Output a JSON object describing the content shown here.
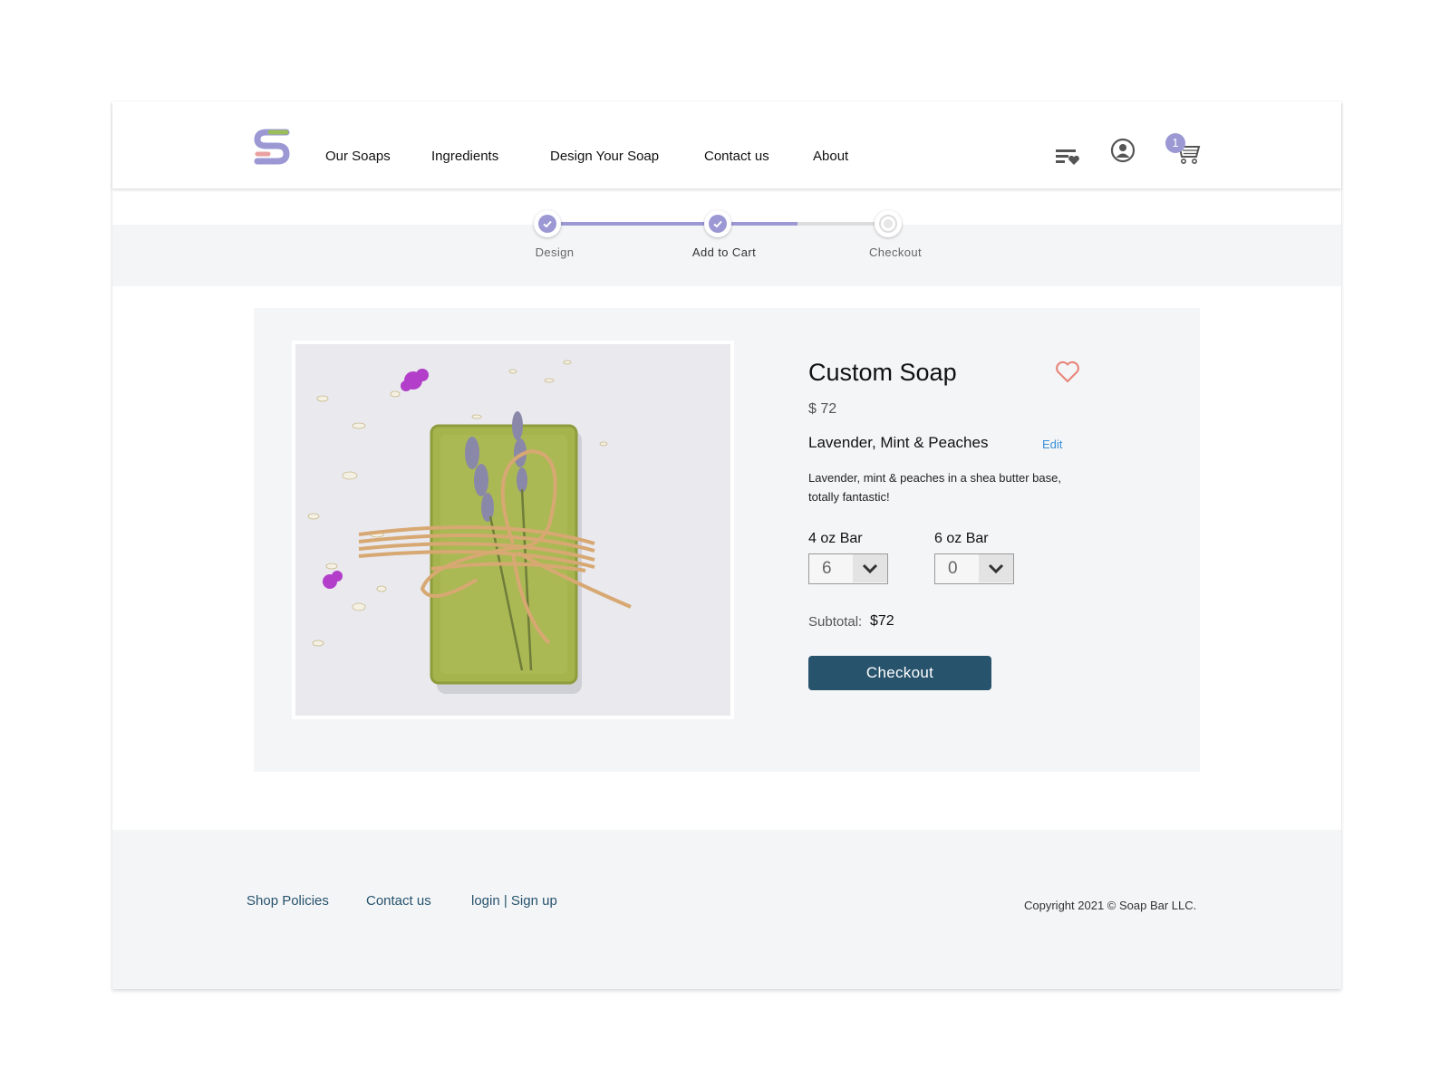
{
  "nav": {
    "items": [
      {
        "label": "Our Soaps"
      },
      {
        "label": "Ingredients"
      },
      {
        "label": "Design Your Soap"
      },
      {
        "label": "Contact us"
      },
      {
        "label": "About"
      }
    ],
    "cart_count": "1",
    "icons": [
      "wishlist-icon",
      "account-icon",
      "cart-icon"
    ]
  },
  "stepper": {
    "steps": [
      {
        "label": "Design",
        "state": "done"
      },
      {
        "label": "Add to Cart",
        "state": "done"
      },
      {
        "label": "Checkout",
        "state": "pending"
      }
    ]
  },
  "product": {
    "title": "Custom Soap",
    "price": "$ 72",
    "name": "Lavender, Mint & Peaches",
    "edit_label": "Edit",
    "description": "Lavender, mint & peaches in a shea butter base, totally fantastic!",
    "sizes": [
      {
        "label": "4 oz Bar",
        "quantity": "6"
      },
      {
        "label": "6 oz Bar",
        "quantity": "0"
      }
    ],
    "subtotal_label": "Subtotal:",
    "subtotal": "$72",
    "checkout_label": "Checkout"
  },
  "footer": {
    "links": [
      {
        "label": "Shop Policies"
      },
      {
        "label": "Contact us"
      },
      {
        "label": "login | Sign up"
      }
    ],
    "copyright": "Copyright 2021 © Soap Bar LLC."
  },
  "colors": {
    "accent": "#9b98d4",
    "button": "#27536d",
    "heart": "#e8877c",
    "link": "#3a8fd9",
    "panel": "#f4f5f7"
  }
}
